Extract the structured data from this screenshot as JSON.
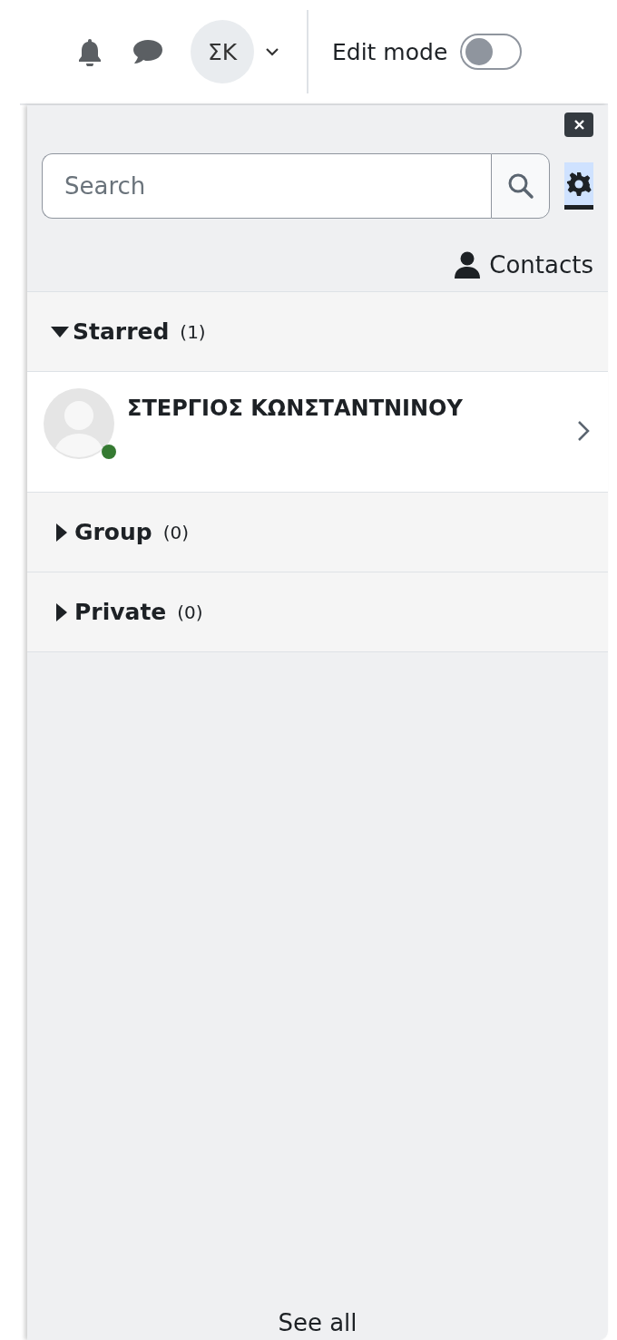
{
  "header": {
    "avatar_initials": "ΣΚ",
    "edit_mode": {
      "label": "Edit mode",
      "on": false
    }
  },
  "drawer": {
    "search": {
      "placeholder": "Search"
    },
    "contacts_link": "Contacts",
    "sections": [
      {
        "title": "Starred",
        "count": "(1)",
        "expanded": true,
        "contacts": [
          {
            "name": "ΣΤΕΡΓΙΟΣ ΚΩΝΣΤΑΝΤΝΙΝΟΥ",
            "online": true
          }
        ]
      },
      {
        "title": "Group",
        "count": "(0)",
        "expanded": false
      },
      {
        "title": "Private",
        "count": "(0)",
        "expanded": false
      }
    ],
    "see_all": "See all"
  }
}
